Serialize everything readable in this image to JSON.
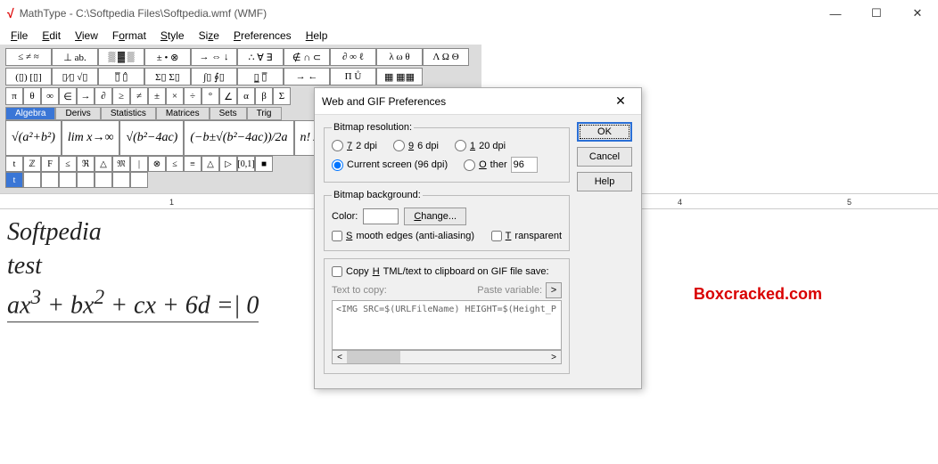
{
  "titlebar": {
    "logo": "√",
    "title": "MathType - C:\\Softpedia Files\\Softpedia.wmf (WMF)"
  },
  "menu": [
    "File",
    "Edit",
    "View",
    "Format",
    "Style",
    "Size",
    "Preferences",
    "Help"
  ],
  "toolrows": {
    "r1": [
      "≤ ≠ ≈",
      "⊥ ab.",
      "▒ ▓ ▒",
      "± • ⊗",
      "→ ⇔ ↓",
      "∴ ∀ ∃",
      "∉ ∩ ⊂",
      "∂ ∞ ℓ",
      "λ ω θ",
      "Λ Ω Θ"
    ],
    "r2": [
      "(▯) [▯]",
      "▯⁄▯ √▯",
      "▯̅ ▯̂",
      "Σ▯ Σ▯",
      "∫▯ ∮▯",
      "▯̲ ▯̅",
      "→ ←",
      "Π Ů",
      "▦ ▦▦"
    ]
  },
  "tabs": [
    "Algebra",
    "Derivs",
    "Statistics",
    "Matrices",
    "Sets",
    "Trig"
  ],
  "formulas": [
    "√(a²+b²)",
    "lim x→∞",
    "√(b²−4ac)",
    "(−b±√(b²−4ac))/2a",
    "n! / r!(n−r)!"
  ],
  "smallrow": [
    "t",
    "ℤ",
    "F",
    "≤",
    "ℜ",
    "△",
    "𝔐",
    "|",
    "⊗",
    "≤",
    "≡",
    "△",
    "▷",
    "[0,1]",
    "■"
  ],
  "editor": {
    "line1": "Softpedia",
    "line2": "test",
    "equation_html": "<i>ax</i><sup>3</sup> + <i>bx</i><sup>2</sup> + <i>cx</i> + 6<i>d</i> = 0"
  },
  "watermark": "Boxcracked.com",
  "dialog": {
    "title": "Web and GIF Preferences",
    "res_legend": "Bitmap resolution:",
    "res_opts": [
      "72 dpi",
      "96 dpi",
      "120 dpi",
      "Current screen (96 dpi)",
      "Other"
    ],
    "res_other_val": "96",
    "bg_legend": "Bitmap background:",
    "color_label": "Color:",
    "change": "Change...",
    "smooth": "Smooth edges (anti-aliasing)",
    "transparent": "Transparent",
    "copy_chk": "Copy HTML/text to clipboard on GIF file save:",
    "text_to_copy": "Text to copy:",
    "paste_var": "Paste variable:",
    "textbox": "<IMG SRC=$(URLFileName) HEIGHT=$(Height_P",
    "ok": "OK",
    "cancel": "Cancel",
    "help": "Help"
  }
}
